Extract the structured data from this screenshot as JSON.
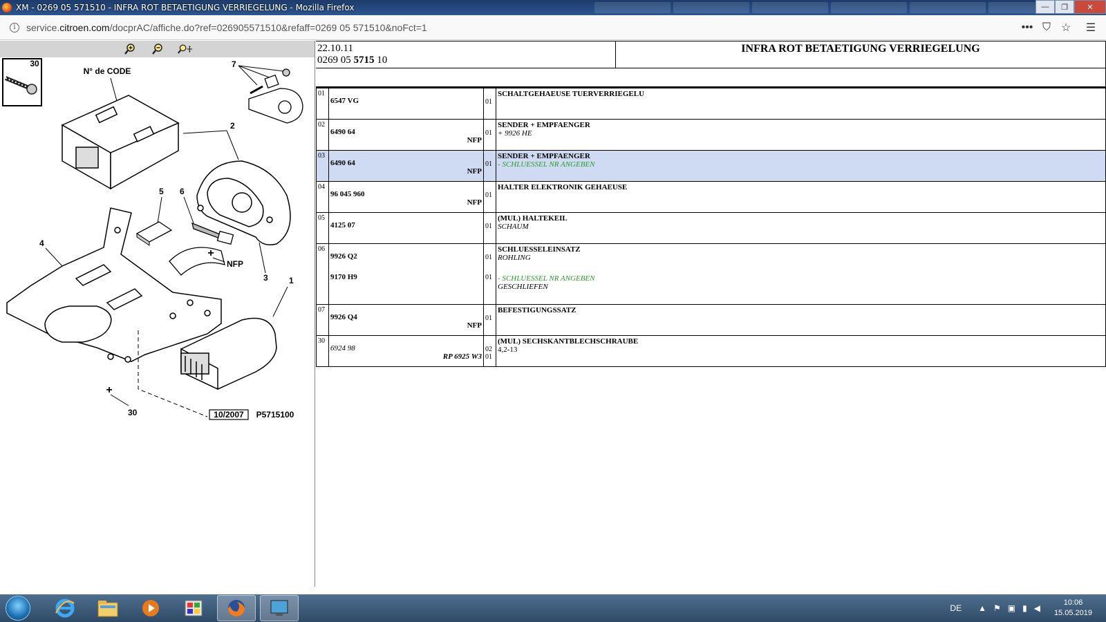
{
  "window": {
    "title": "XM - 0269 05 571510 - INFRA ROT BETAETIGUNG VERRIEGELUNG - Mozilla Firefox",
    "minimize": "—",
    "restore": "❐",
    "close": "✕"
  },
  "address": {
    "url_prefix": "service.",
    "url_domain": "citroen.com",
    "url_rest": "/docprAC/affiche.do?ref=026905571510&refaff=0269 05 571510&noFct=1",
    "info": "i",
    "more": "•••",
    "pocket": "⛉",
    "star": "☆",
    "menu": "☰"
  },
  "diagram": {
    "code_label": "N° de CODE",
    "inset_number": "30",
    "callouts": [
      "1",
      "2",
      "3",
      "4",
      "5",
      "6",
      "7",
      "30"
    ],
    "nfp_label": "NFP",
    "date_code": "10/2007",
    "plate_code": "P5715100"
  },
  "header": {
    "date": "22.10.11",
    "ref_prefix": "0269 05 ",
    "ref_bold": "5715",
    "ref_suffix": " 10",
    "title": "INFRA ROT BETAETIGUNG VERRIEGELUNG"
  },
  "parts": [
    {
      "pos": "01",
      "refs": [
        {
          "ref": "6547 VG",
          "qty": "01"
        }
      ],
      "nfp": "",
      "title": "SCHALTGEHAEUSE TUERVERRIEGELU",
      "notes": []
    },
    {
      "pos": "02",
      "refs": [
        {
          "ref": "6490 64",
          "qty": "01"
        }
      ],
      "nfp": "NFP",
      "title": "SENDER + EMPFAENGER",
      "notes": [
        "+ 9926 HE"
      ]
    },
    {
      "pos": "03",
      "refs": [
        {
          "ref": "6490 64",
          "qty": "01"
        }
      ],
      "nfp": "NFP",
      "title": "SENDER + EMPFAENGER",
      "notes": [
        "- SCHLUESSEL NR ANGEBEN"
      ],
      "highlight": true
    },
    {
      "pos": "04",
      "refs": [
        {
          "ref": "96 045 960",
          "qty": "01"
        }
      ],
      "nfp": "NFP",
      "title": "HALTER ELEKTRONIK GEHAEUSE",
      "notes": []
    },
    {
      "pos": "05",
      "refs": [
        {
          "ref": "4125 07",
          "qty": "01"
        }
      ],
      "nfp": "",
      "title": "(MUL) HALTEKEIL",
      "notes": [
        "SCHAUM"
      ]
    },
    {
      "pos": "06",
      "refs": [
        {
          "ref": "9926 Q2",
          "qty": "01"
        },
        {
          "ref": "9170 H9",
          "qty": "01"
        }
      ],
      "nfp": "",
      "title": "SCHLUESSELEINSATZ",
      "notes": [
        "ROHLING"
      ],
      "notes2": [
        "- SCHLUESSEL NR ANGEBEN",
        "GESCHLIEFEN"
      ]
    },
    {
      "pos": "07",
      "refs": [
        {
          "ref": "9926 Q4",
          "qty": "01"
        }
      ],
      "nfp": "NFP",
      "title": "BEFESTIGUNGSSATZ",
      "notes": []
    },
    {
      "pos": "30",
      "refs": [
        {
          "ref": "6924 98",
          "qty": "02"
        }
      ],
      "nfp": "RP 6925 W3",
      "nfp_qty": "01",
      "title": "(MUL) SECHSKANTBLECHSCHRAUBE",
      "notes": [
        "4,2-13"
      ]
    }
  ],
  "taskbar": {
    "language": "DE",
    "time": "10:06",
    "date": "15.05.2019"
  },
  "colors": {
    "highlight_row": "#cfdbf3",
    "note_green": "#2a9a2a"
  }
}
